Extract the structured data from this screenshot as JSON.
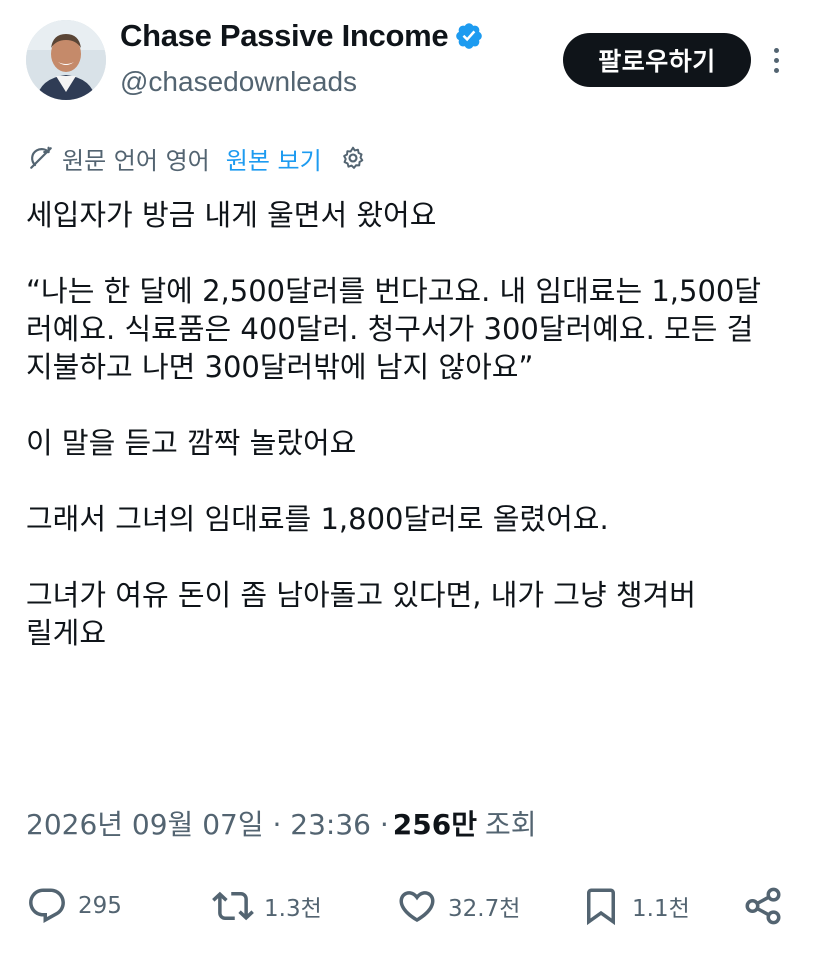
{
  "user": {
    "display_name": "Chase Passive Income",
    "handle": "@chasedownleads",
    "follow_label": "팔로우하기"
  },
  "translation": {
    "source_language_text": "원문 언어 영어",
    "view_original_label": "원본 보기"
  },
  "tweet": {
    "paragraphs": [
      "세입자가 방금 내게 울면서 왔어요",
      "“나는 한 달에 2,500달러를 번다고요. 내 임대료는 1,500달러예요. 식료품은 400달러. 청구서가 300달러예요. 모든 걸 지불하고 나면 300달러밖에 남지 않아요”",
      "이 말을 듣고 깜짝 놀랐어요",
      "그래서 그녀의 임대료를 1,800달러로 올렸어요.",
      "그녀가 여유 돈이 좀 남아돌고 있다면, 내가 그냥 챙겨버릴게요"
    ],
    "date_time": "2026년 09월 07일 · 23:36 ·",
    "views_count": "256만",
    "views_label": "조회"
  },
  "actions": {
    "reply_count": "295",
    "retweet_count": "1.3천",
    "like_count": "32.7천",
    "bookmark_count": "1.1천"
  },
  "colors": {
    "text_primary": "#0f1419",
    "text_secondary": "#536471",
    "link_blue": "#1d9bf0",
    "verified_blue": "#1d9bf0",
    "follow_button_bg": "#0f1419"
  },
  "icons": {
    "more": "more-icon",
    "verified": "verified-badge-icon",
    "translate": "translate-icon",
    "settings": "gear-icon",
    "reply": "reply-icon",
    "retweet": "retweet-icon",
    "like": "heart-icon",
    "bookmark": "bookmark-icon",
    "share": "share-icon"
  }
}
